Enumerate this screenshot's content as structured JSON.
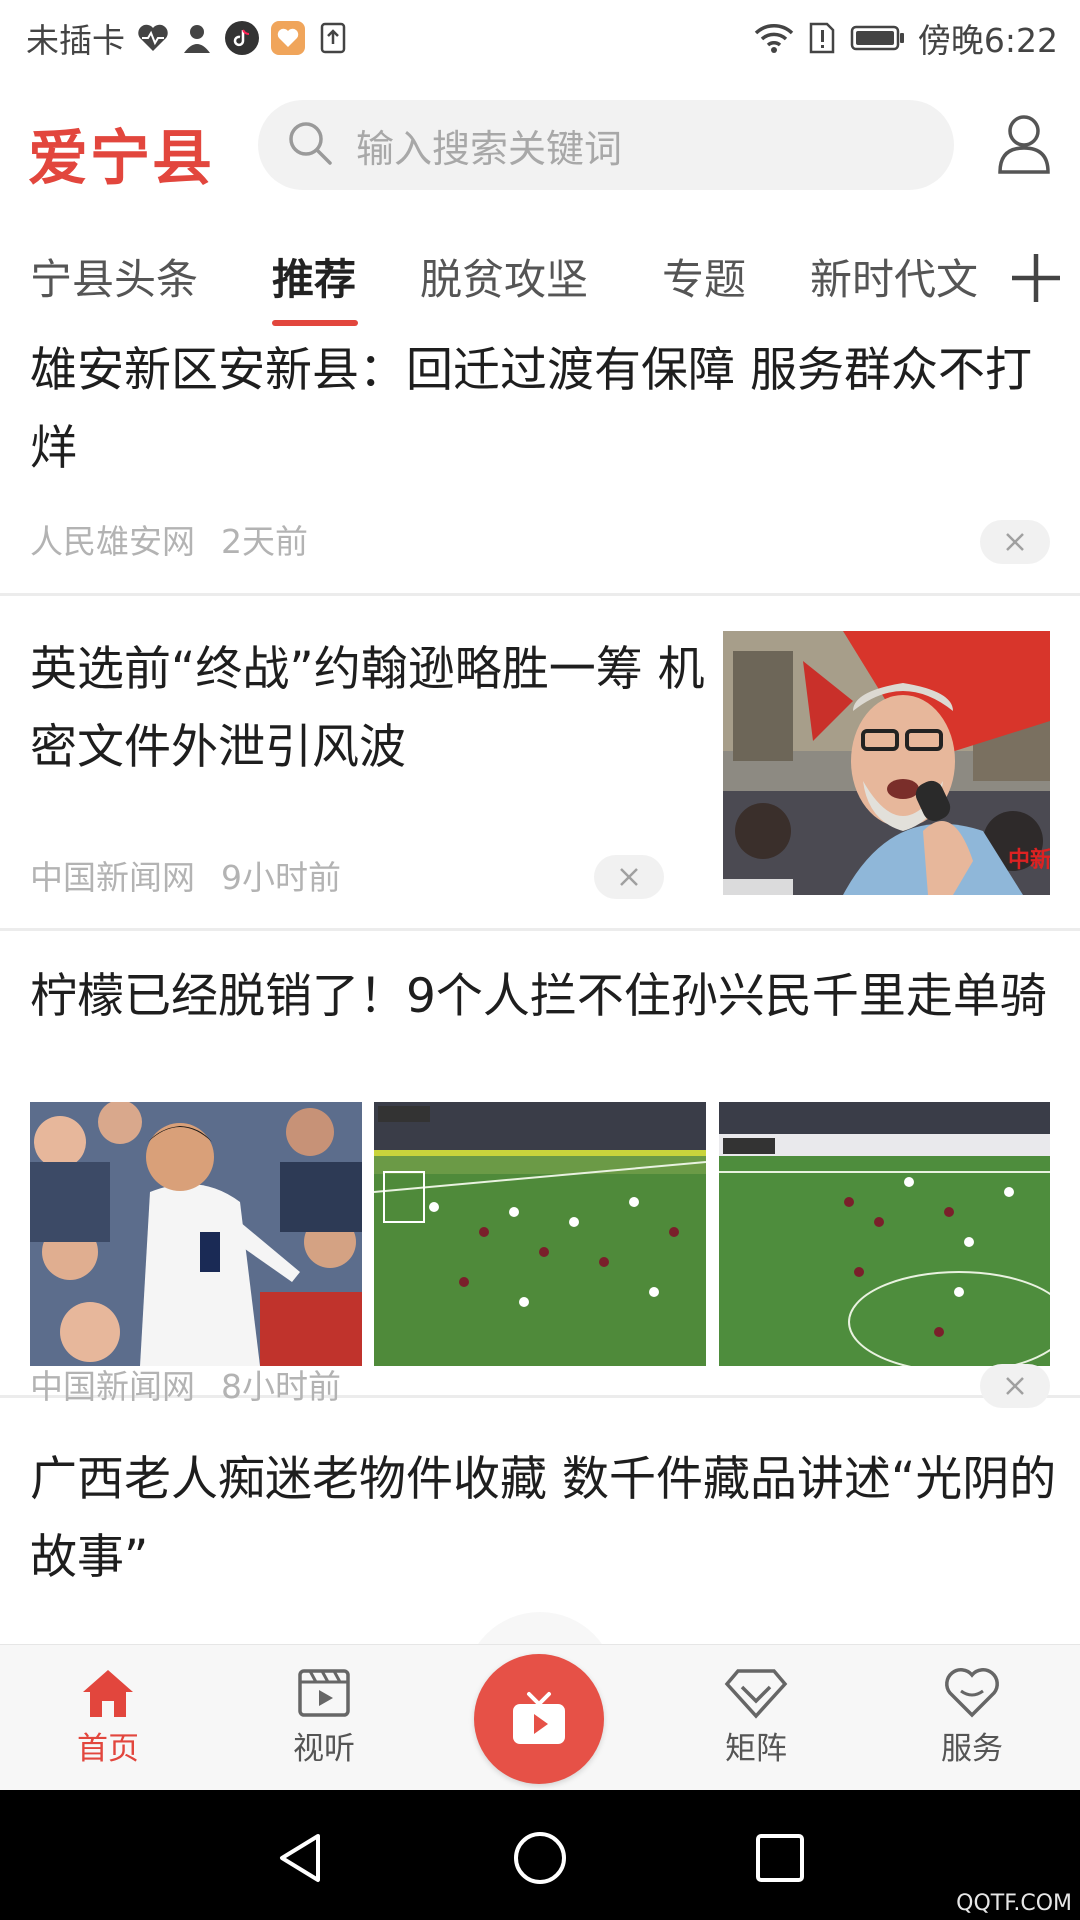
{
  "status_bar": {
    "carrier": "未插卡",
    "time_label": "傍晚6:22",
    "icons": [
      "heart-rate-icon",
      "person-icon",
      "tiktok-icon",
      "app-icon",
      "upload-icon",
      "wifi-icon",
      "sim-alert-icon",
      "battery-icon"
    ]
  },
  "header": {
    "logo": "爱宁县",
    "search_placeholder": "输入搜索关键词",
    "accent_color": "#e2463d"
  },
  "tabs": [
    {
      "label": "宁县头条",
      "active": false
    },
    {
      "label": "推荐",
      "active": true
    },
    {
      "label": "脱贫攻坚",
      "active": false
    },
    {
      "label": "专题",
      "active": false
    },
    {
      "label": "新时代文",
      "active": false
    }
  ],
  "articles": [
    {
      "title": "雄安新区安新县：回迁过渡有保障 服务群众不打烊",
      "source": "人民雄安网",
      "time": "2天前",
      "images": 0
    },
    {
      "title": "英选前“终战”约翰逊略胜一筹 机密文件外泄引风波",
      "source": "中国新闻网",
      "time": "9小时前",
      "images": 1,
      "image_caption": "中新"
    },
    {
      "title": "柠檬已经脱销了！9个人拦不住孙兴民千里走单骑",
      "source": "中国新闻网",
      "time": "8小时前",
      "images": 3
    },
    {
      "title": "广西老人痴迷老物件收藏 数千件藏品讲述“光阴的故事”",
      "source": "",
      "time": "",
      "images": 0
    }
  ],
  "bottom_nav": [
    {
      "label": "首页",
      "icon": "home-icon",
      "active": true
    },
    {
      "label": "视听",
      "icon": "video-icon",
      "active": false
    },
    {
      "label": "",
      "icon": "tv-icon",
      "active": false
    },
    {
      "label": "矩阵",
      "icon": "diamond-icon",
      "active": false
    },
    {
      "label": "服务",
      "icon": "heart-icon",
      "active": false
    }
  ],
  "watermark": "QQTF.COM"
}
